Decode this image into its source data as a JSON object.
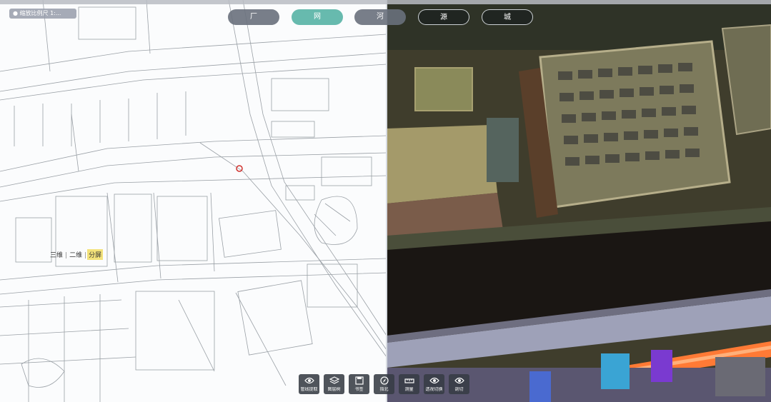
{
  "layer_tag": "● 缩放比例尺 1:...",
  "chips": [
    {
      "label": "厂",
      "style": "gray"
    },
    {
      "label": "网",
      "style": "teal"
    },
    {
      "label": "河",
      "style": "gray"
    },
    {
      "label": "源",
      "style": "dark"
    },
    {
      "label": "城",
      "style": "dark"
    }
  ],
  "view_modes": {
    "three_d": "三维",
    "two_d": "二维",
    "split": "分屏",
    "active": "分屏"
  },
  "toolbar": [
    {
      "label": "管线提取",
      "icon": "eye-icon"
    },
    {
      "label": "图层树",
      "icon": "layers-icon"
    },
    {
      "label": "书签",
      "icon": "save-icon"
    },
    {
      "label": "指北",
      "icon": "compass-icon"
    },
    {
      "label": "测量",
      "icon": "ruler-icon"
    },
    {
      "label": "透视切换",
      "icon": "eye-icon"
    },
    {
      "label": "剖切",
      "icon": "eye-icon"
    }
  ],
  "colors": {
    "chip_active": "#5fb6aa",
    "chip_default": "#69707c",
    "mode_active": "#f3e27a"
  }
}
